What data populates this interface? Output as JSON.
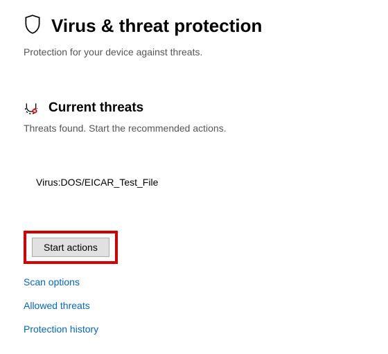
{
  "header": {
    "title": "Virus & threat protection",
    "subtitle": "Protection for your device against threats."
  },
  "current_threats": {
    "title": "Current threats",
    "subtitle": "Threats found. Start the recommended actions.",
    "items": [
      "Virus:DOS/EICAR_Test_File"
    ]
  },
  "actions": {
    "start_button": "Start actions",
    "links": {
      "scan_options": "Scan options",
      "allowed_threats": "Allowed threats",
      "protection_history": "Protection history"
    }
  }
}
